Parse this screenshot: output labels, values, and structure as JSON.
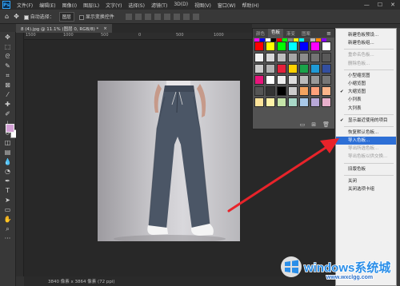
{
  "app": {
    "logo_text": "Ps"
  },
  "menubar": {
    "items": [
      "文件(F)",
      "编辑(E)",
      "图像(I)",
      "图层(L)",
      "文字(Y)",
      "选择(S)",
      "滤镜(T)",
      "3D(D)",
      "视图(V)",
      "窗口(W)",
      "帮助(H)"
    ],
    "controls": [
      "—",
      "☐",
      "✕"
    ]
  },
  "options_bar": {
    "auto_select_label": "自动选择：",
    "auto_select_value": "图层",
    "show_transform_label": "显示变换控件"
  },
  "document_tab": {
    "title": "8 (4).jpg @ 11.1% (图层 0, RGB/8) *",
    "close": "×"
  },
  "ruler_top": [
    "1500",
    "1000",
    "500",
    "0",
    "500",
    "1000"
  ],
  "status_bar": {
    "text": "3840 像素 x 3864 像素 (72 ppi)"
  },
  "swatches_panel": {
    "tabs": [
      "颜色",
      "色板",
      "渐变",
      "图案"
    ],
    "active_tab": "色板",
    "menu_icon": "hamburger-menu-icon",
    "recent_colors": [
      "#ff00ff",
      "#0000ff",
      "#ffffff",
      "#000000",
      "#ff0000",
      "#00ff00",
      "#888888",
      "#ffff00",
      "#00ffff",
      "#444444",
      "#bbbbbb",
      "#ff8800",
      "#8800ff"
    ],
    "grid_colors": [
      "#ff0000",
      "#ffff00",
      "#00ff00",
      "#00ffff",
      "#0000ff",
      "#ff00ff",
      "#ffffff",
      "#f2f2f2",
      "#d9d9d9",
      "#bfbfbf",
      "#a6a6a6",
      "#8c8c8c",
      "#737373",
      "#595959",
      "#cccccc",
      "#b3b3b3",
      "#e5203b",
      "#ffd200",
      "#1aa34a",
      "#1f9ad6",
      "#334fa0",
      "#e9157c",
      "#ffffff",
      "#eeeeee",
      "#dddddd",
      "#bbbbbb",
      "#999999",
      "#777777",
      "#555555",
      "#333333",
      "#000000",
      "#cccccc",
      "#f4a460",
      "#ffa07a",
      "#fbb58a",
      "#fde39a",
      "#fff2a8",
      "#c5e4a8",
      "#a8d8c8",
      "#a8c8e8",
      "#b8a8d8",
      "#e8b0cc"
    ]
  },
  "flyout_menu": {
    "items": [
      {
        "label": "新建色板预设...",
        "state": "normal"
      },
      {
        "label": "新建色板组...",
        "state": "normal"
      },
      {
        "sep": true
      },
      {
        "label": "重命名色板...",
        "state": "disabled"
      },
      {
        "label": "删除色板...",
        "state": "disabled"
      },
      {
        "sep": true
      },
      {
        "label": "小型缩览图",
        "state": "normal"
      },
      {
        "label": "小缩览图",
        "state": "normal"
      },
      {
        "label": "大缩览图",
        "state": "checked"
      },
      {
        "label": "小列表",
        "state": "normal"
      },
      {
        "label": "大列表",
        "state": "normal"
      },
      {
        "sep": true
      },
      {
        "label": "显示最近使用的项目",
        "state": "checked"
      },
      {
        "sep": true
      },
      {
        "label": "恢复默认色板...",
        "state": "normal"
      },
      {
        "label": "导入色板...",
        "state": "highlighted"
      },
      {
        "label": "导出所选色板...",
        "state": "disabled"
      },
      {
        "label": "导出色板以供交换...",
        "state": "disabled"
      },
      {
        "sep": true
      },
      {
        "label": "旧版色板",
        "state": "normal"
      },
      {
        "sep": true
      },
      {
        "label": "关闭",
        "state": "normal"
      },
      {
        "label": "关闭选项卡组",
        "state": "normal"
      }
    ]
  },
  "annotation": {
    "arrow_color": "#e8232a"
  },
  "watermark": {
    "title": "windows系统城",
    "url": "www.wxclgg.com",
    "logo_color": "#2a8ee8"
  }
}
